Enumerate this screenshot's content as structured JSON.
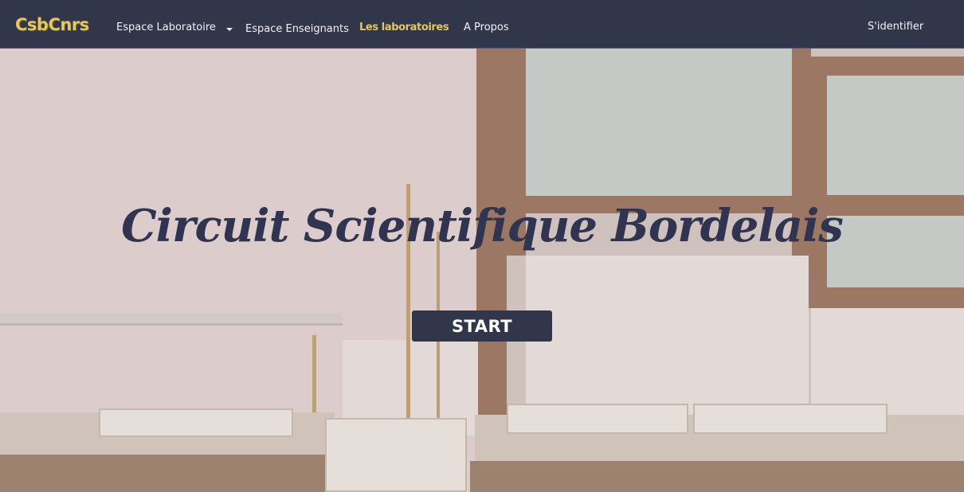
{
  "brand": "CsbCnrs",
  "nav": {
    "espace_laboratoire": "Espace Laboratoire",
    "espace_enseignants": "Espace Enseignants",
    "les_laboratoires": "Les laboratoires",
    "a_propos": "A Propos",
    "sidentifier": "S'identifier"
  },
  "hero": {
    "title": "Circuit Scientifique Bordelais",
    "start_label": "START"
  },
  "colors": {
    "navbar": "#32364b",
    "brand_accent": "#e1c765",
    "button": "#32364b"
  }
}
